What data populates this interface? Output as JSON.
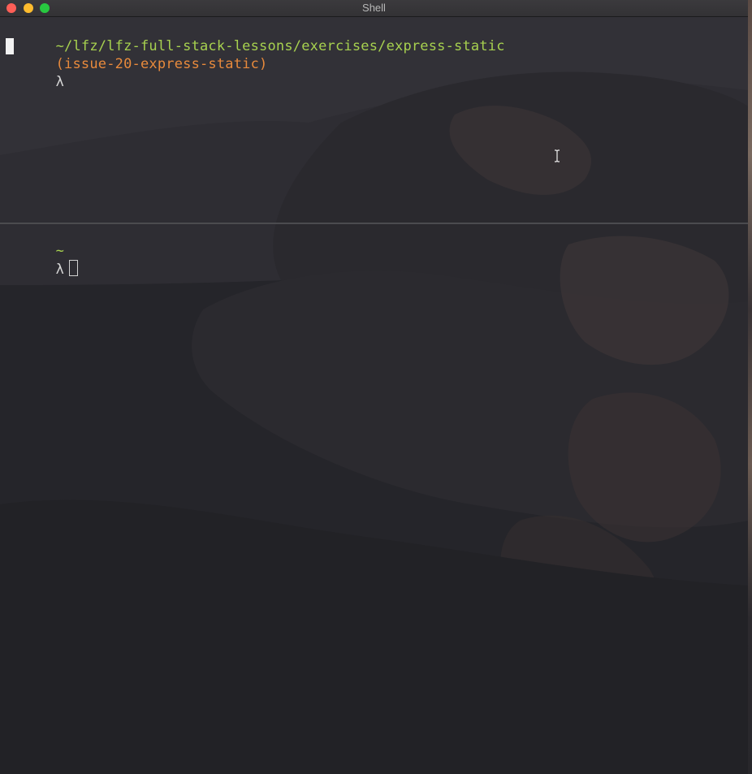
{
  "window": {
    "title": "Shell"
  },
  "pane_top": {
    "path": "~/lfz/lfz-full-stack-lessons/exercises/express-static",
    "branch": "(issue-20-express-static)",
    "prompt_symbol": "λ"
  },
  "pane_bottom": {
    "path": "~",
    "prompt_symbol": "λ"
  },
  "colors": {
    "path": "#a7d14f",
    "branch": "#e88a3c",
    "background": "#232327"
  },
  "icons": {
    "close": "close-icon",
    "minimize": "minimize-icon",
    "maximize": "maximize-icon",
    "text_cursor": "i-beam-cursor-icon"
  }
}
